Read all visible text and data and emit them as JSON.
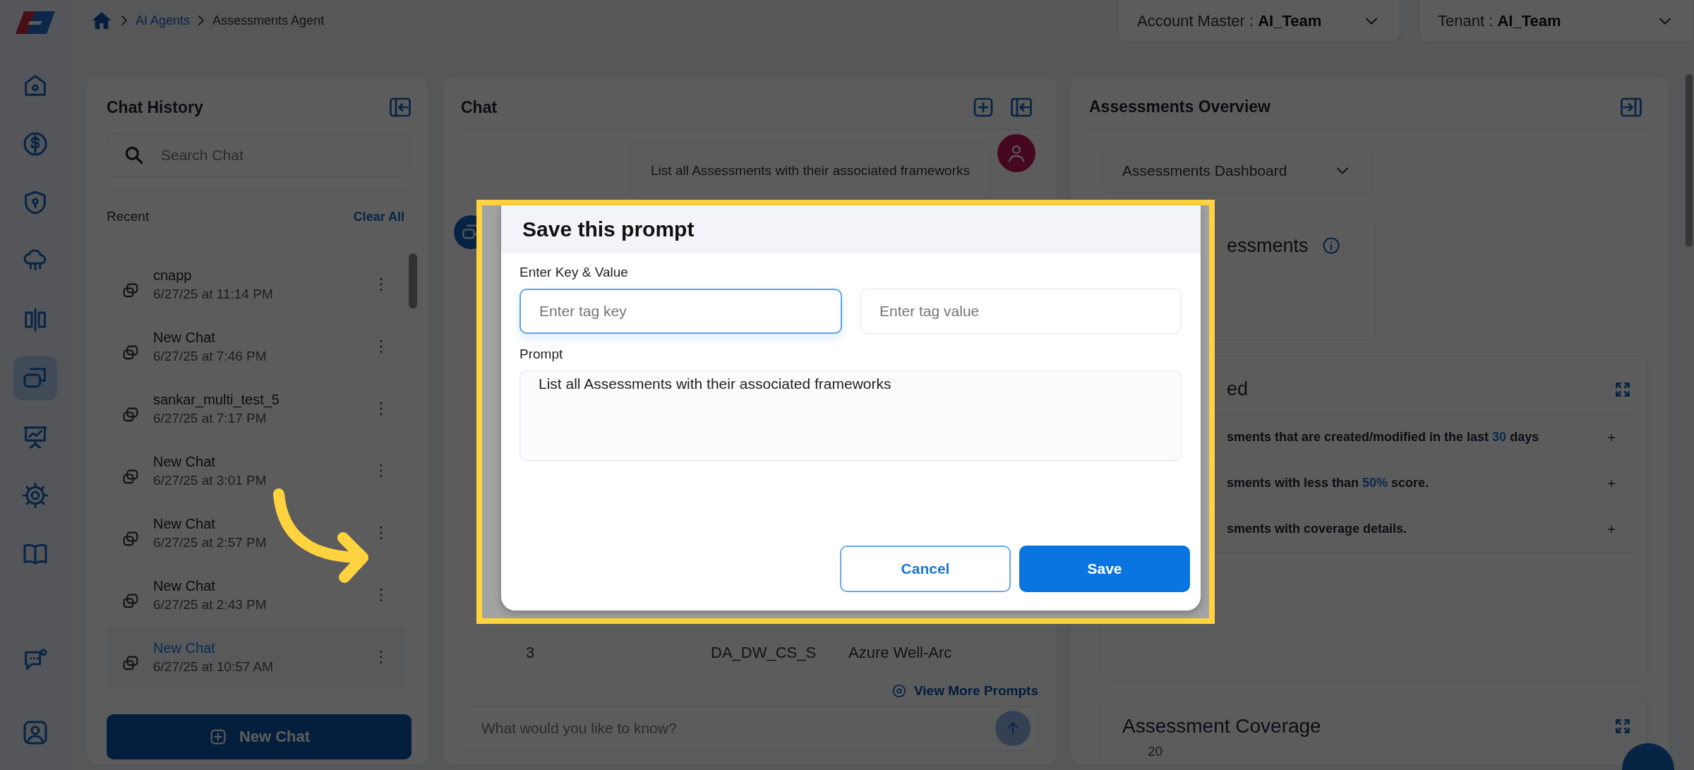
{
  "nav_rail": {
    "items": [
      {
        "selected": false
      },
      {
        "selected": false
      },
      {
        "selected": false
      },
      {
        "selected": false
      },
      {
        "selected": false
      },
      {
        "selected": true
      },
      {
        "selected": false
      },
      {
        "selected": false
      },
      {
        "selected": false
      }
    ],
    "bottom_items": [
      {
        "selected": false
      },
      {
        "selected": false
      }
    ]
  },
  "breadcrumbs": [
    {
      "label": "AI Agents",
      "kind": "link"
    },
    {
      "label": "Assessments Agent",
      "kind": "current"
    }
  ],
  "selectors": [
    {
      "label": "Account Master : ",
      "value": "AI_Team"
    },
    {
      "label": "Tenant : ",
      "value": "AI_Team"
    }
  ],
  "chat_history": {
    "title": "Chat History",
    "search": {
      "placeholder": "Search Chat"
    },
    "section": "Recent",
    "clear_all": "Clear All",
    "items": [
      {
        "name": "cnapp",
        "time": "6/27/25 at 11:14 PM",
        "selected": false
      },
      {
        "name": "New Chat",
        "time": "6/27/25 at 7:46 PM",
        "selected": false
      },
      {
        "name": "sankar_multi_test_5",
        "time": "6/27/25 at 7:17 PM",
        "selected": false
      },
      {
        "name": "New Chat",
        "time": "6/27/25 at 3:01 PM",
        "selected": false
      },
      {
        "name": "New Chat",
        "time": "6/27/25 at 2:57 PM",
        "selected": false
      },
      {
        "name": "New Chat",
        "time": "6/27/25 at 2:43 PM",
        "selected": false
      },
      {
        "name": "New Chat",
        "time": "6/27/25 at 10:57 AM",
        "selected": true
      }
    ],
    "new_chat": "New Chat"
  },
  "chat": {
    "title": "Chat",
    "user_message": "List all Assessments with their associated frameworks",
    "table_row": [
      "3",
      "DA_DW_CS_S",
      "Azure Well-Arc"
    ],
    "view_more": "View More Prompts",
    "input": {
      "placeholder": "What would you like to know?"
    }
  },
  "overview": {
    "title": "Assessments Overview",
    "dropdown": "Assessments Dashboard",
    "card_title": "essments",
    "list_title": "ed",
    "suggestions": [
      {
        "parts": [
          {
            "kind": "plain",
            "text": "sments that are created/modified in the last "
          },
          {
            "kind": "highlight",
            "text": "30"
          },
          {
            "kind": "plain",
            "text": " days"
          }
        ]
      },
      {
        "parts": [
          {
            "kind": "plain",
            "text": "sments with less than "
          },
          {
            "kind": "highlight",
            "text": "50%"
          },
          {
            "kind": "plain",
            "text": " score."
          }
        ]
      },
      {
        "parts": [
          {
            "kind": "plain",
            "text": "sments with coverage details."
          }
        ]
      }
    ],
    "coverage": {
      "title": "Assessment Coverage",
      "tick": "20"
    }
  },
  "dialog": {
    "title": "Save this prompt",
    "key_value_label": "Enter Key & Value",
    "key_field": {
      "placeholder": "Enter tag key",
      "focused": true
    },
    "value_field": {
      "placeholder": "Enter tag value",
      "focused": false
    },
    "prompt_label": "Prompt",
    "prompt": "List all Assessments with their associated frameworks",
    "buttons": [
      {
        "label": "Cancel",
        "kind": "secondary"
      },
      {
        "label": "Save",
        "kind": "primary"
      }
    ]
  }
}
